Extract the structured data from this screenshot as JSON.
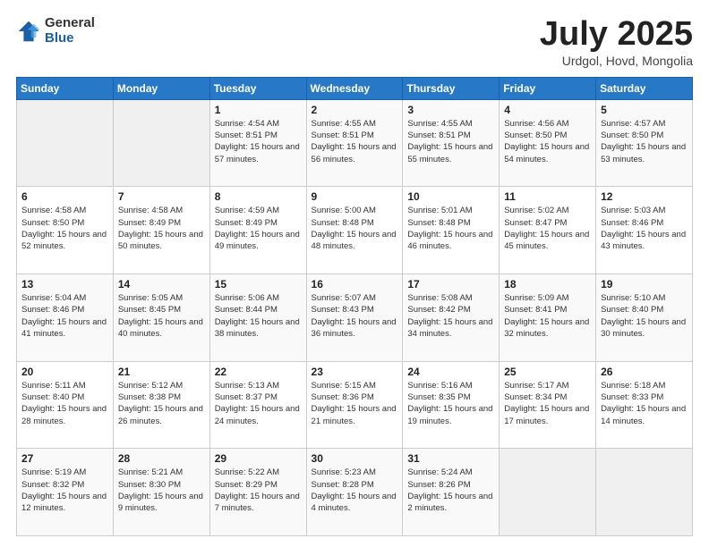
{
  "logo": {
    "general": "General",
    "blue": "Blue"
  },
  "title": {
    "month": "July 2025",
    "location": "Urdgol, Hovd, Mongolia"
  },
  "headers": [
    "Sunday",
    "Monday",
    "Tuesday",
    "Wednesday",
    "Thursday",
    "Friday",
    "Saturday"
  ],
  "weeks": [
    [
      {
        "num": "",
        "sunrise": "",
        "sunset": "",
        "daylight": ""
      },
      {
        "num": "",
        "sunrise": "",
        "sunset": "",
        "daylight": ""
      },
      {
        "num": "1",
        "sunrise": "Sunrise: 4:54 AM",
        "sunset": "Sunset: 8:51 PM",
        "daylight": "Daylight: 15 hours and 57 minutes."
      },
      {
        "num": "2",
        "sunrise": "Sunrise: 4:55 AM",
        "sunset": "Sunset: 8:51 PM",
        "daylight": "Daylight: 15 hours and 56 minutes."
      },
      {
        "num": "3",
        "sunrise": "Sunrise: 4:55 AM",
        "sunset": "Sunset: 8:51 PM",
        "daylight": "Daylight: 15 hours and 55 minutes."
      },
      {
        "num": "4",
        "sunrise": "Sunrise: 4:56 AM",
        "sunset": "Sunset: 8:50 PM",
        "daylight": "Daylight: 15 hours and 54 minutes."
      },
      {
        "num": "5",
        "sunrise": "Sunrise: 4:57 AM",
        "sunset": "Sunset: 8:50 PM",
        "daylight": "Daylight: 15 hours and 53 minutes."
      }
    ],
    [
      {
        "num": "6",
        "sunrise": "Sunrise: 4:58 AM",
        "sunset": "Sunset: 8:50 PM",
        "daylight": "Daylight: 15 hours and 52 minutes."
      },
      {
        "num": "7",
        "sunrise": "Sunrise: 4:58 AM",
        "sunset": "Sunset: 8:49 PM",
        "daylight": "Daylight: 15 hours and 50 minutes."
      },
      {
        "num": "8",
        "sunrise": "Sunrise: 4:59 AM",
        "sunset": "Sunset: 8:49 PM",
        "daylight": "Daylight: 15 hours and 49 minutes."
      },
      {
        "num": "9",
        "sunrise": "Sunrise: 5:00 AM",
        "sunset": "Sunset: 8:48 PM",
        "daylight": "Daylight: 15 hours and 48 minutes."
      },
      {
        "num": "10",
        "sunrise": "Sunrise: 5:01 AM",
        "sunset": "Sunset: 8:48 PM",
        "daylight": "Daylight: 15 hours and 46 minutes."
      },
      {
        "num": "11",
        "sunrise": "Sunrise: 5:02 AM",
        "sunset": "Sunset: 8:47 PM",
        "daylight": "Daylight: 15 hours and 45 minutes."
      },
      {
        "num": "12",
        "sunrise": "Sunrise: 5:03 AM",
        "sunset": "Sunset: 8:46 PM",
        "daylight": "Daylight: 15 hours and 43 minutes."
      }
    ],
    [
      {
        "num": "13",
        "sunrise": "Sunrise: 5:04 AM",
        "sunset": "Sunset: 8:46 PM",
        "daylight": "Daylight: 15 hours and 41 minutes."
      },
      {
        "num": "14",
        "sunrise": "Sunrise: 5:05 AM",
        "sunset": "Sunset: 8:45 PM",
        "daylight": "Daylight: 15 hours and 40 minutes."
      },
      {
        "num": "15",
        "sunrise": "Sunrise: 5:06 AM",
        "sunset": "Sunset: 8:44 PM",
        "daylight": "Daylight: 15 hours and 38 minutes."
      },
      {
        "num": "16",
        "sunrise": "Sunrise: 5:07 AM",
        "sunset": "Sunset: 8:43 PM",
        "daylight": "Daylight: 15 hours and 36 minutes."
      },
      {
        "num": "17",
        "sunrise": "Sunrise: 5:08 AM",
        "sunset": "Sunset: 8:42 PM",
        "daylight": "Daylight: 15 hours and 34 minutes."
      },
      {
        "num": "18",
        "sunrise": "Sunrise: 5:09 AM",
        "sunset": "Sunset: 8:41 PM",
        "daylight": "Daylight: 15 hours and 32 minutes."
      },
      {
        "num": "19",
        "sunrise": "Sunrise: 5:10 AM",
        "sunset": "Sunset: 8:40 PM",
        "daylight": "Daylight: 15 hours and 30 minutes."
      }
    ],
    [
      {
        "num": "20",
        "sunrise": "Sunrise: 5:11 AM",
        "sunset": "Sunset: 8:40 PM",
        "daylight": "Daylight: 15 hours and 28 minutes."
      },
      {
        "num": "21",
        "sunrise": "Sunrise: 5:12 AM",
        "sunset": "Sunset: 8:38 PM",
        "daylight": "Daylight: 15 hours and 26 minutes."
      },
      {
        "num": "22",
        "sunrise": "Sunrise: 5:13 AM",
        "sunset": "Sunset: 8:37 PM",
        "daylight": "Daylight: 15 hours and 24 minutes."
      },
      {
        "num": "23",
        "sunrise": "Sunrise: 5:15 AM",
        "sunset": "Sunset: 8:36 PM",
        "daylight": "Daylight: 15 hours and 21 minutes."
      },
      {
        "num": "24",
        "sunrise": "Sunrise: 5:16 AM",
        "sunset": "Sunset: 8:35 PM",
        "daylight": "Daylight: 15 hours and 19 minutes."
      },
      {
        "num": "25",
        "sunrise": "Sunrise: 5:17 AM",
        "sunset": "Sunset: 8:34 PM",
        "daylight": "Daylight: 15 hours and 17 minutes."
      },
      {
        "num": "26",
        "sunrise": "Sunrise: 5:18 AM",
        "sunset": "Sunset: 8:33 PM",
        "daylight": "Daylight: 15 hours and 14 minutes."
      }
    ],
    [
      {
        "num": "27",
        "sunrise": "Sunrise: 5:19 AM",
        "sunset": "Sunset: 8:32 PM",
        "daylight": "Daylight: 15 hours and 12 minutes."
      },
      {
        "num": "28",
        "sunrise": "Sunrise: 5:21 AM",
        "sunset": "Sunset: 8:30 PM",
        "daylight": "Daylight: 15 hours and 9 minutes."
      },
      {
        "num": "29",
        "sunrise": "Sunrise: 5:22 AM",
        "sunset": "Sunset: 8:29 PM",
        "daylight": "Daylight: 15 hours and 7 minutes."
      },
      {
        "num": "30",
        "sunrise": "Sunrise: 5:23 AM",
        "sunset": "Sunset: 8:28 PM",
        "daylight": "Daylight: 15 hours and 4 minutes."
      },
      {
        "num": "31",
        "sunrise": "Sunrise: 5:24 AM",
        "sunset": "Sunset: 8:26 PM",
        "daylight": "Daylight: 15 hours and 2 minutes."
      },
      {
        "num": "",
        "sunrise": "",
        "sunset": "",
        "daylight": ""
      },
      {
        "num": "",
        "sunrise": "",
        "sunset": "",
        "daylight": ""
      }
    ]
  ]
}
